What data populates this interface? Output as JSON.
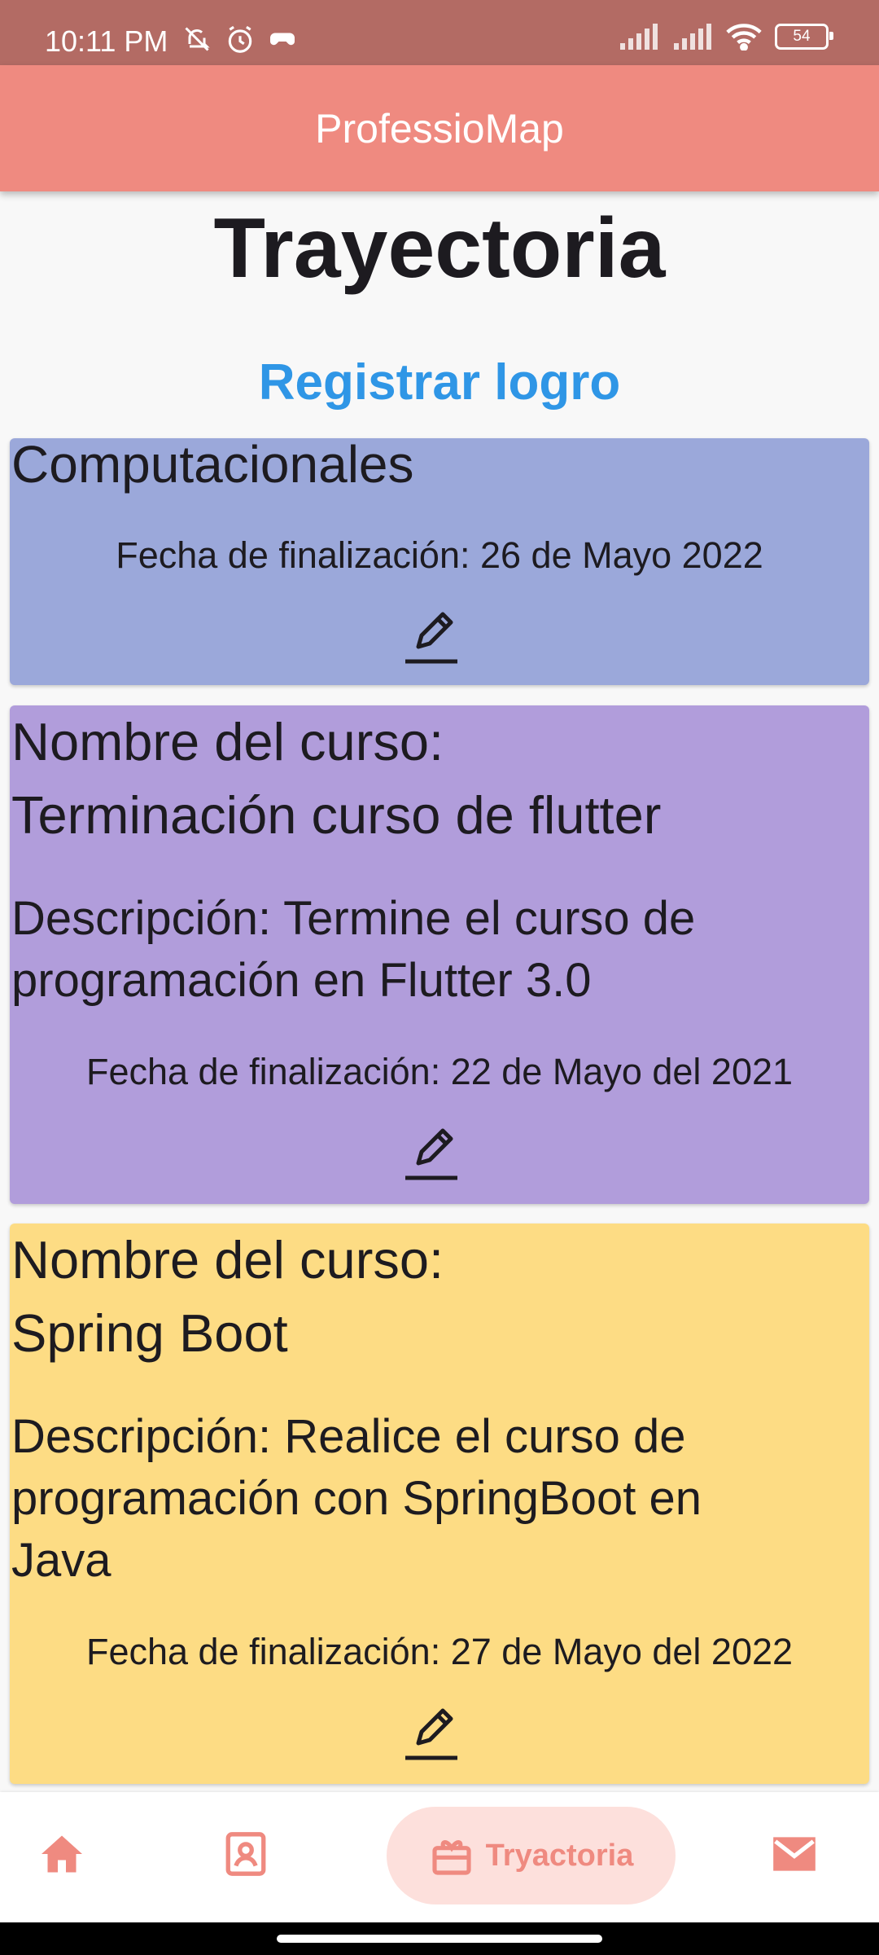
{
  "status_bar": {
    "time": "10:11 PM",
    "battery": "54",
    "icons": [
      "bell-off-icon",
      "alarm-icon",
      "game-icon",
      "signal-icon",
      "signal-icon",
      "wifi-icon",
      "battery-icon"
    ]
  },
  "app_bar": {
    "title": "ProfessioMap"
  },
  "page": {
    "title": "Trayectoria",
    "register_label": "Registrar logro"
  },
  "cards": [
    {
      "title": "Computacionales",
      "date": "Fecha de finalización: 26 de Mayo 2022",
      "color": "#9ba8da"
    },
    {
      "title_line1": "Nombre del curso:",
      "title_line2": "Terminación curso de flutter",
      "desc_line1": "Descripción: Termine el curso de",
      "desc_line2": "programación en Flutter 3.0",
      "date": "Fecha de finalización: 22 de Mayo del 2021",
      "color": "#b19ddb"
    },
    {
      "title_line1": "Nombre del curso:",
      "title_line2": "Spring Boot",
      "desc_line1": "Descripción: Realice el curso de",
      "desc_line2": "programación con SpringBoot en",
      "desc_line3": "Java",
      "date": "Fecha de finalización: 27 de Mayo del 2022",
      "color": "#fddc84"
    }
  ],
  "bottom_nav": {
    "items": [
      {
        "icon": "home-icon"
      },
      {
        "icon": "contact-card-icon"
      },
      {
        "icon": "trajectory-icon",
        "label": "Tryactoria",
        "active": true
      },
      {
        "icon": "mail-icon"
      }
    ],
    "accent": "#ef8a80"
  }
}
